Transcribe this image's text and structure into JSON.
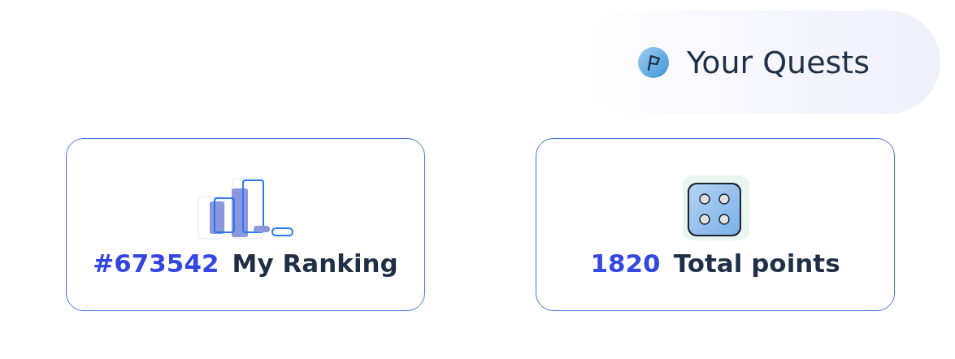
{
  "header": {
    "title": "Your Quests"
  },
  "cards": [
    {
      "kind": "ranking",
      "value": "#673542",
      "label": "My Ranking"
    },
    {
      "kind": "points",
      "value": "1820",
      "label": "Total points"
    }
  ]
}
